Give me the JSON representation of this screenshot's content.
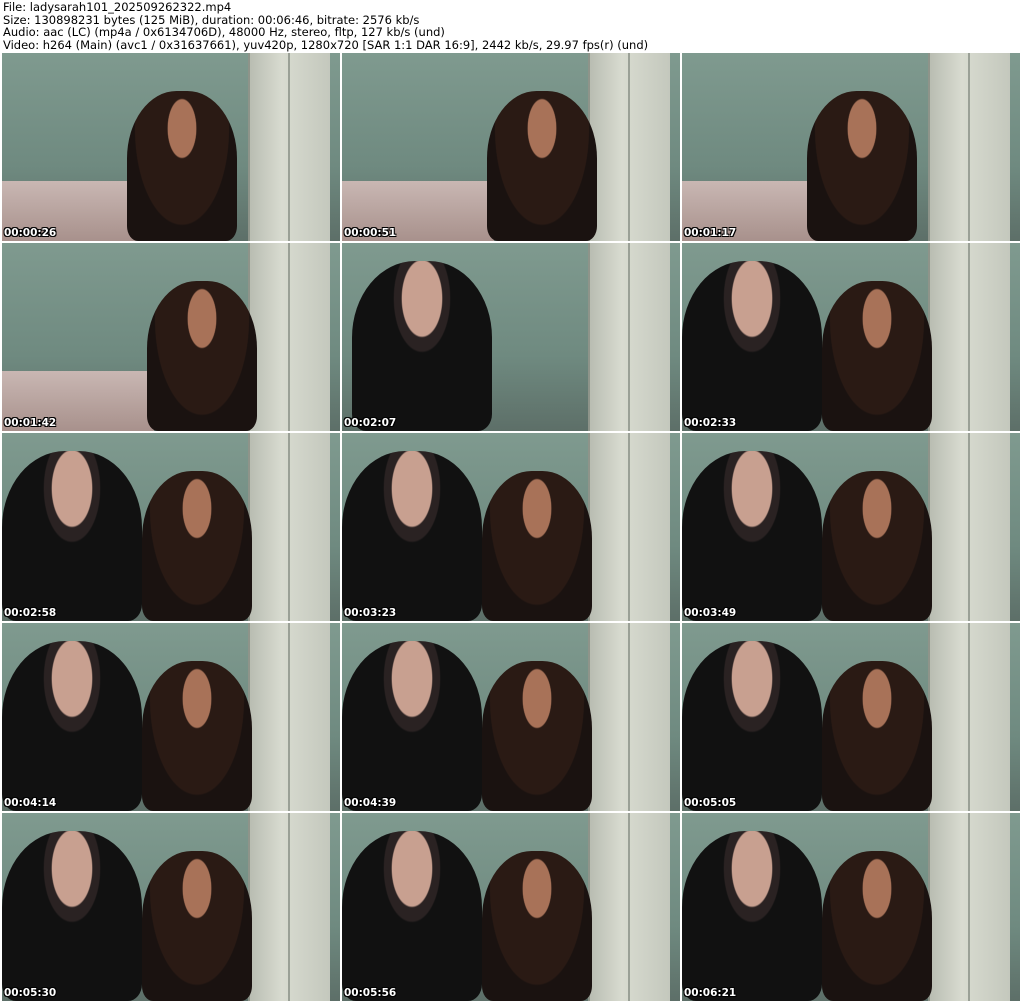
{
  "header": {
    "file": "File: ladysarah101_202509262322.mp4",
    "size": "Size: 130898231 bytes (125 MiB), duration: 00:06:46, bitrate: 2576 kb/s",
    "audio": "Audio: aac (LC) (mp4a / 0x6134706D), 48000 Hz, stereo, fltp, 127 kb/s (und)",
    "video": "Video: h264 (Main) (avc1 / 0x31637661), yuv420p, 1280x720 [SAR 1:1 DAR 16:9], 2442 kb/s, 29.97 fps(r) (und)"
  },
  "thumbnails": [
    {
      "time": "00:00:26",
      "scene": "woman"
    },
    {
      "time": "00:00:51",
      "scene": "woman"
    },
    {
      "time": "00:01:17",
      "scene": "woman"
    },
    {
      "time": "00:01:42",
      "scene": "woman"
    },
    {
      "time": "00:02:07",
      "scene": "man"
    },
    {
      "time": "00:02:33",
      "scene": "both"
    },
    {
      "time": "00:02:58",
      "scene": "both"
    },
    {
      "time": "00:03:23",
      "scene": "both"
    },
    {
      "time": "00:03:49",
      "scene": "both"
    },
    {
      "time": "00:04:14",
      "scene": "both"
    },
    {
      "time": "00:04:39",
      "scene": "both"
    },
    {
      "time": "00:05:05",
      "scene": "both"
    },
    {
      "time": "00:05:30",
      "scene": "both"
    },
    {
      "time": "00:05:56",
      "scene": "both"
    },
    {
      "time": "00:06:21",
      "scene": "both"
    }
  ]
}
